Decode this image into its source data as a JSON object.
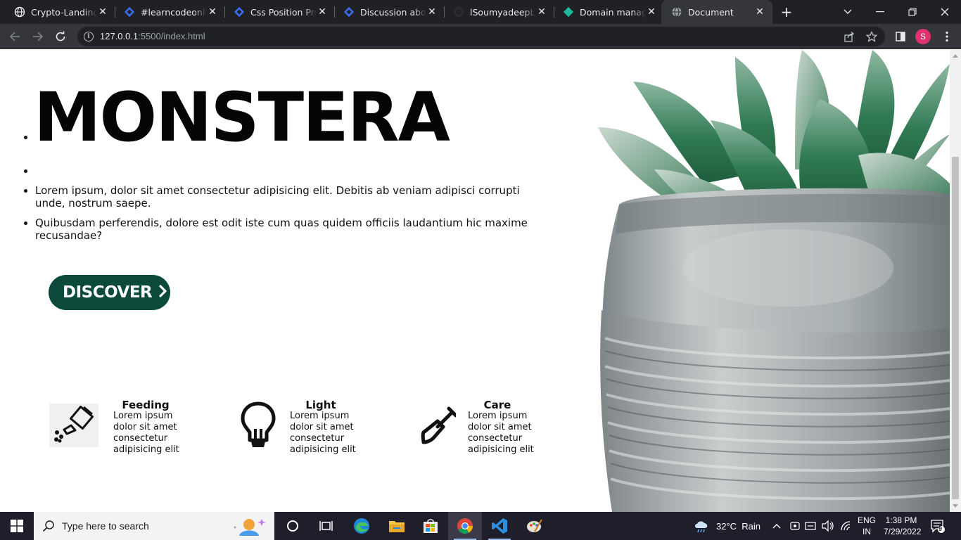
{
  "browser": {
    "tabs": [
      {
        "title": "Crypto-Landing-Page",
        "icon": "globe-icon"
      },
      {
        "title": "#learncodeonline",
        "icon": "discord-diamond-icon"
      },
      {
        "title": "Css Position Property",
        "icon": "discord-diamond-icon"
      },
      {
        "title": "Discussion about",
        "icon": "discord-diamond-icon"
      },
      {
        "title": "lSoumyadeepLah",
        "icon": "github-icon"
      },
      {
        "title": "Domain manager",
        "icon": "teal-diamond-icon"
      },
      {
        "title": "Document",
        "icon": "globe-icon",
        "active": true
      }
    ],
    "new_tab": "+",
    "url_host": "127.0.0.1",
    "url_rest": ":5500/index.html",
    "profile_initial": "S"
  },
  "page": {
    "title": "MONSTERA",
    "paragraphs": [
      "Lorem ipsum, dolor sit amet consectetur adipisicing elit. Debitis ab veniam adipisci corrupti unde, nostrum saepe.",
      "Quibusdam perferendis, dolore est odit iste cum quas quidem officiis laudantium hic maxime recusandae?"
    ],
    "button_label": "DISCOVER",
    "features": [
      {
        "title": "Feeding",
        "text": "Lorem ipsum dolor sit amet consectetur adipisicing elit",
        "icon": "watering-can-icon"
      },
      {
        "title": "Light",
        "text": "Lorem ipsum dolor sit amet consectetur adipisicing elit",
        "icon": "light-bulb-icon"
      },
      {
        "title": "Care",
        "text": "Lorem ipsum dolor sit amet consectetur adipisicing elit",
        "icon": "shovel-icon"
      }
    ]
  },
  "taskbar": {
    "search_placeholder": "Type here to search",
    "weather": "32°C  Rain",
    "language": "ENG",
    "region": "IN",
    "time": "1:38 PM",
    "date": "7/29/2022",
    "notifications": "9"
  },
  "colors": {
    "chrome_dark": "#202124",
    "chrome_toolbar": "#35363a",
    "button_green": "#0b4a3b",
    "taskbar": "#1f1f2b"
  }
}
